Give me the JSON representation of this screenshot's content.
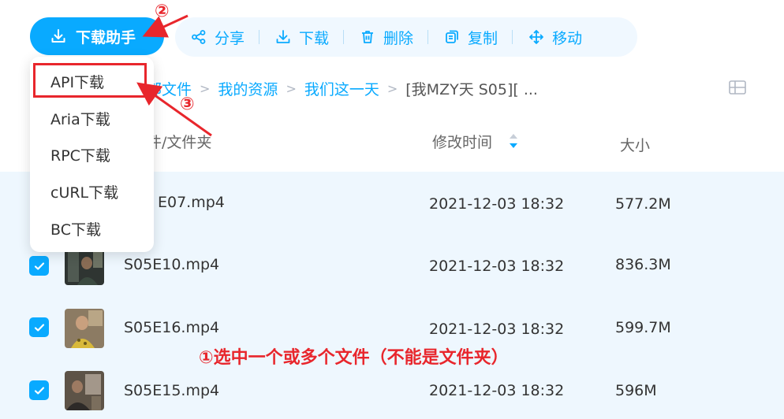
{
  "toolbar": {
    "download_helper_label": "下载助手",
    "actions": [
      {
        "label": "分享",
        "icon": "share-icon"
      },
      {
        "label": "下载",
        "icon": "download-icon"
      },
      {
        "label": "删除",
        "icon": "trash-icon"
      },
      {
        "label": "复制",
        "icon": "copy-icon"
      },
      {
        "label": "移动",
        "icon": "move-icon"
      }
    ]
  },
  "breadcrumb": {
    "items": [
      "部文件",
      "我的资源",
      "我们这一天"
    ],
    "current": "[我MZY天 S05][ ..."
  },
  "table": {
    "headers": {
      "name": "件/文件夹",
      "modified": "修改时间",
      "size": "大小"
    },
    "rows": [
      {
        "name": "E07.mp4",
        "modified": "2021-12-03 18:32",
        "size": "577.2M"
      },
      {
        "name": "S05E10.mp4",
        "modified": "2021-12-03 18:32",
        "size": "836.3M"
      },
      {
        "name": "S05E16.mp4",
        "modified": "2021-12-03 18:32",
        "size": "599.7M"
      },
      {
        "name": "S05E15.mp4",
        "modified": "2021-12-03 18:32",
        "size": "596M"
      }
    ]
  },
  "dropdown": {
    "items": [
      "API下载",
      "Aria下载",
      "RPC下载",
      "cURL下载",
      "BC下载"
    ]
  },
  "annotations": {
    "step1": "①选中一个或多个文件（不能是文件夹）",
    "step2": "②",
    "step3": "③"
  },
  "colors": {
    "accent": "#09aaff",
    "annotation_red": "#e8262c",
    "row_highlight": "#eef7fe"
  }
}
